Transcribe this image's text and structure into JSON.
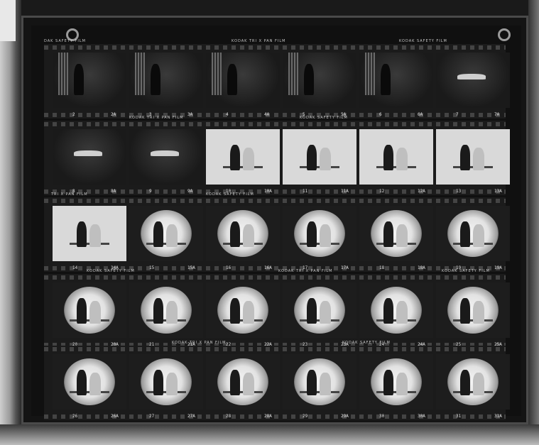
{
  "strips": [
    {
      "edge_text": [
        "DAK SAFETY FILM",
        "KODAK TRI X PAN FILM",
        "KODAK SAFETY FILM"
      ],
      "frames": [
        {
          "num": "2",
          "numA": "2A",
          "style": "curtain"
        },
        {
          "num": "3",
          "numA": "3A",
          "style": "curtain"
        },
        {
          "num": "4",
          "numA": "4A",
          "style": "curtain"
        },
        {
          "num": "5",
          "numA": "5A",
          "style": "curtain"
        },
        {
          "num": "6",
          "numA": "6A",
          "style": "curtain"
        },
        {
          "num": "7",
          "numA": "7A",
          "style": "dark"
        }
      ]
    },
    {
      "edge_text": [
        "KODAK TRI X PAN FILM",
        "KODAK SAFETY FILM"
      ],
      "frames": [
        {
          "num": "8",
          "numA": "8A",
          "style": "dark"
        },
        {
          "num": "9",
          "numA": "9A",
          "style": "dark"
        },
        {
          "num": "10",
          "numA": "10A",
          "style": "white"
        },
        {
          "num": "11",
          "numA": "11A",
          "style": "white"
        },
        {
          "num": "12",
          "numA": "12A",
          "style": "white"
        },
        {
          "num": "13",
          "numA": "13A",
          "style": "white"
        }
      ]
    },
    {
      "edge_text": [
        "TRI X PAN FILM",
        "KODAK SAFETY FILM"
      ],
      "frames": [
        {
          "num": "14",
          "numA": "14A",
          "style": "white"
        },
        {
          "num": "15",
          "numA": "15A",
          "style": "spot"
        },
        {
          "num": "16",
          "numA": "16A",
          "style": "spot"
        },
        {
          "num": "17",
          "numA": "17A",
          "style": "spot"
        },
        {
          "num": "18",
          "numA": "18A",
          "style": "spot"
        },
        {
          "num": "19",
          "numA": "19A",
          "style": "spot"
        }
      ]
    },
    {
      "edge_text": [
        "KODAK SAFETY FILM",
        "KODAK TRI X PAN FILM",
        "KODAK SAFETY FILM"
      ],
      "frames": [
        {
          "num": "20",
          "numA": "20A",
          "style": "spot"
        },
        {
          "num": "21",
          "numA": "21A",
          "style": "spot"
        },
        {
          "num": "22",
          "numA": "22A",
          "style": "spot"
        },
        {
          "num": "23",
          "numA": "23A",
          "style": "spot"
        },
        {
          "num": "24",
          "numA": "24A",
          "style": "spot"
        },
        {
          "num": "25",
          "numA": "25A",
          "style": "spot"
        }
      ]
    },
    {
      "edge_text": [
        "KODAK TRI X PAN FILM",
        "KODAK SAFETY FILM"
      ],
      "frames": [
        {
          "num": "26",
          "numA": "26A",
          "style": "spot"
        },
        {
          "num": "27",
          "numA": "27A",
          "style": "spot"
        },
        {
          "num": "28",
          "numA": "28A",
          "style": "spot"
        },
        {
          "num": "29",
          "numA": "29A",
          "style": "spot"
        },
        {
          "num": "30",
          "numA": "30A",
          "style": "spot"
        },
        {
          "num": "31",
          "numA": "31A",
          "style": "spot"
        }
      ]
    }
  ]
}
